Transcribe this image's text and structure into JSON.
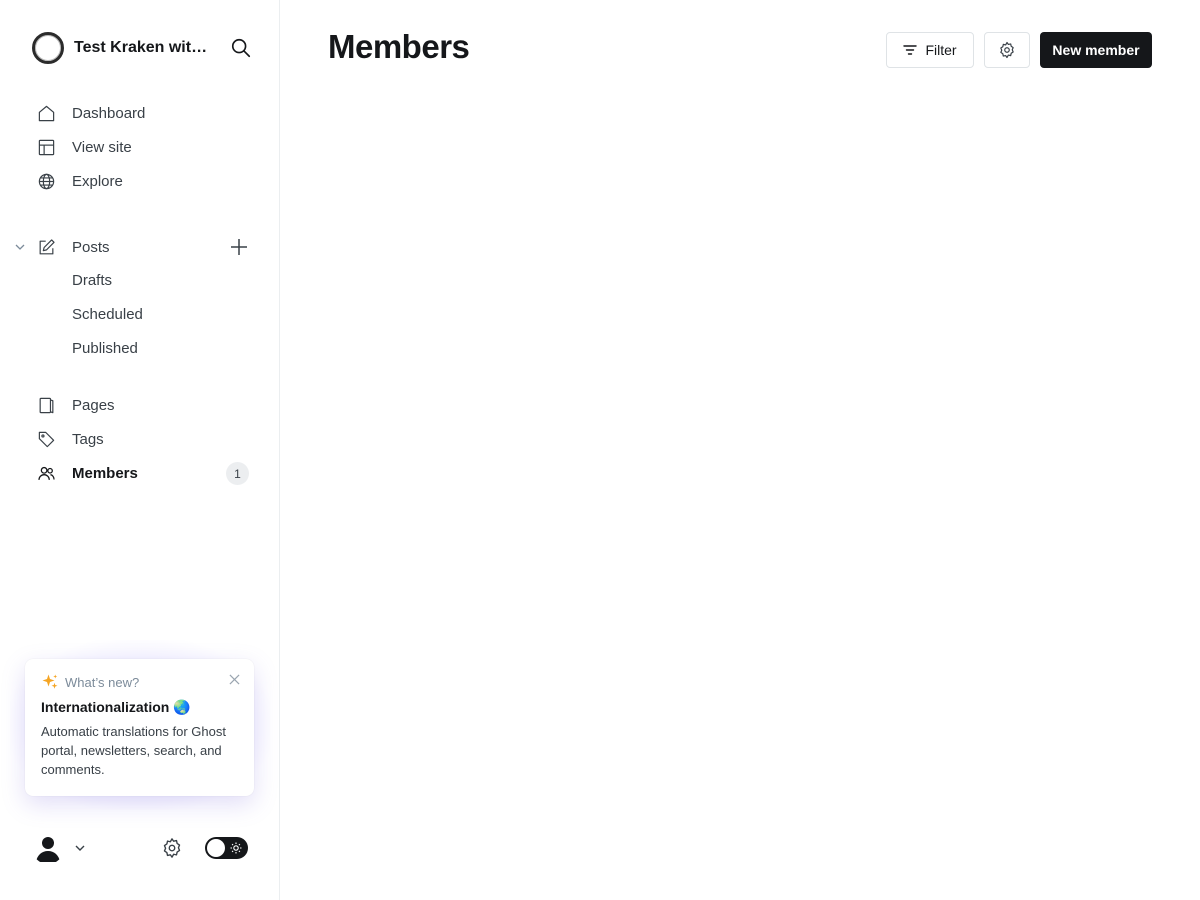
{
  "site": {
    "title": "Test Kraken wit…"
  },
  "nav": {
    "dashboard": "Dashboard",
    "view_site": "View site",
    "explore": "Explore",
    "posts": "Posts",
    "drafts": "Drafts",
    "scheduled": "Scheduled",
    "published": "Published",
    "pages": "Pages",
    "tags": "Tags",
    "members": "Members",
    "members_count": "1"
  },
  "whats_new": {
    "label": "What’s new?",
    "title": "Internationalization 🌏",
    "body": "Automatic translations for Ghost portal, newsletters, search, and comments."
  },
  "main": {
    "title": "Members",
    "filter_label": "Filter",
    "new_member_label": "New member"
  },
  "colors": {
    "primary": "#15171a",
    "badge_bg": "#eceef0",
    "border": "#ebeef0"
  },
  "icons": [
    "search-icon",
    "home-icon",
    "layout-icon",
    "globe-icon",
    "chevron-down-icon",
    "edit-icon",
    "plus-icon",
    "page-icon",
    "tag-icon",
    "members-icon",
    "sparkle-icon",
    "close-icon",
    "user-icon",
    "gear-icon",
    "sun-icon",
    "filter-icon"
  ]
}
